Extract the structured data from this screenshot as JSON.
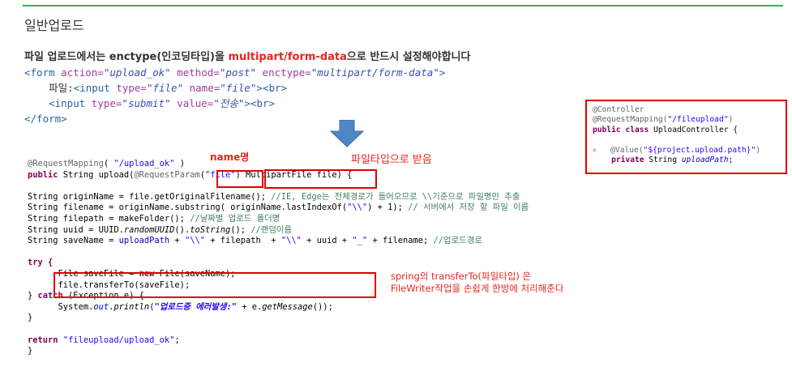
{
  "heading": "일반업로드",
  "intro": {
    "before": "파일 업로드에서는 enctype(인코딩타입)을 ",
    "highlight": "multipart/form-data",
    "after": "으로 반드시 설정해야합니다"
  },
  "html_code": {
    "form_open_tag": "<form",
    "action_attr": " action=",
    "action_val": "\"upload_ok\"",
    "method_attr": " method=",
    "method_val": "\"post\"",
    "enctype_attr": " enctype=",
    "enctype_val": "\"multipart/form-data\"",
    "close_bracket": ">",
    "file_label": "파일:",
    "input_tag": "<input",
    "type_attr": " type=",
    "file_type_val": "\"file\"",
    "name_attr": " name=",
    "name_val": "\"file\"",
    "br_tag": "><br>",
    "submit_type_val": "\"submit\"",
    "value_attr": " value=",
    "submit_val": "\"전송\"",
    "form_close_tag": "</form>"
  },
  "annotations": {
    "name_label": "name명",
    "type_label": "파일타입으로 받음",
    "spring_line1": "spring의 transferTo(파일타입) 은",
    "spring_line2": "FileWriter작업을 손쉽게 한방에 처리해준다"
  },
  "java": {
    "l1a": "@RequestMapping",
    "l1b": "( ",
    "l1c": "\"/upload_ok\"",
    "l1d": " )",
    "l2a": "public",
    "l2b": " String upload(",
    "l2c": "@RequestParam",
    "l2d": "(",
    "l2e": "\"file\"",
    "l2f": ") MultipartFile file) {",
    "l3a": "String originName = file.getOriginalFilename(); ",
    "l3b": "//IE, Edge는 전체경로가 들어오므로 \\\\기준으로 파일명만 추출",
    "l4a": "String filename = originName.substring( originName.lastIndexOf(",
    "l4b": "\"\\\\\"",
    "l4c": ") + 1); ",
    "l4d": "// 서버에서 저장 할 파일 이름",
    "l5a": "String filepath = makeFolder(); ",
    "l5b": "//날짜별 업로드 폴더명",
    "l6a": "String uuid = UUID.",
    "l6b": "randomUUID",
    "l6c": "().",
    "l6d": "toString",
    "l6e": "(); ",
    "l6f": "//랜덤이름",
    "l7a": "String saveName = ",
    "l7b": "uploadPath",
    "l7c": " + ",
    "l7d": "\"\\\\\"",
    "l7e": " + filepath  + ",
    "l7f": "\"\\\\\"",
    "l7g": " + uuid + ",
    "l7h": "\"_\"",
    "l7i": " + filename; ",
    "l7j": "//업로드경로",
    "l8": "try {",
    "l9a": "File saveFile = ",
    "l9b": "new",
    "l9c": " File(saveName);",
    "l10": "file.transferTo(saveFile);",
    "l11a": "} ",
    "l11b": "catch",
    "l11c": " (Exception e) {",
    "l12a": "System.",
    "l12b": "out",
    "l12c": ".",
    "l12d": "println",
    "l12e": "(",
    "l12f": "\"업로드중 에러발생:\"",
    "l12g": " + e.",
    "l12h": "getMessage",
    "l12i": "());",
    "l13": "}",
    "l14a": "return",
    "l14b": " ",
    "l14c": "\"fileupload/upload_ok\"",
    "l14d": ";",
    "l15": "}"
  },
  "controller": {
    "c1": "@Controller",
    "c2a": "@RequestMapping(",
    "c2b": "\"/fileupload\"",
    "c2c": ")",
    "c3a": "public",
    "c3b": " ",
    "c3c": "class",
    "c3d": " UploadController {",
    "c4bp": "⊕",
    "c4a": "@Value(",
    "c4b": "\"${project.upload.path}\"",
    "c4c": ")",
    "c5a": "private",
    "c5b": " String ",
    "c5c": "uploadPath",
    "c5d": ";"
  },
  "colors": {
    "rule": "#3cae5c",
    "highlight_red": "#e8251f",
    "box_red": "#e10000",
    "arrow_blue": "#4f86c6"
  },
  "icons": {
    "arrow": "down-arrow-icon"
  }
}
